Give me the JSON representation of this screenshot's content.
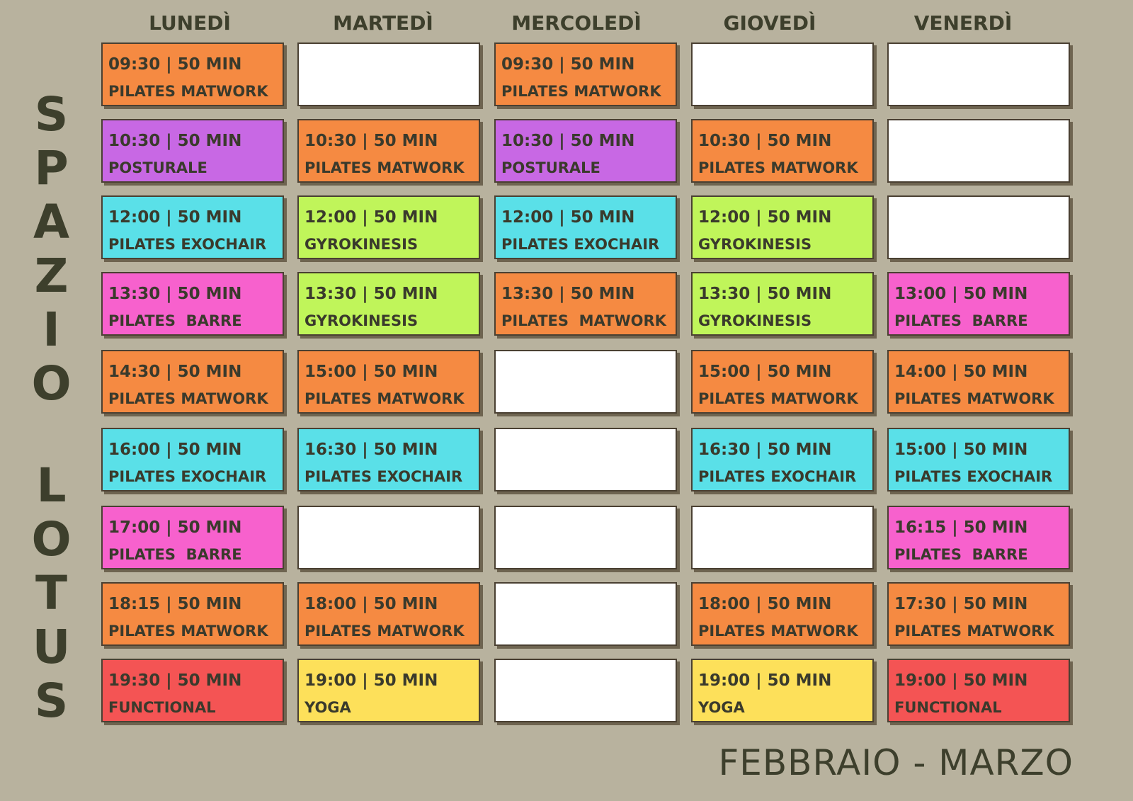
{
  "brand": {
    "word1": "SPAZIO",
    "word2": "LOTUS"
  },
  "days": [
    "LUNEDÌ",
    "MARTEDÌ",
    "MERCOLEDÌ",
    "GIOVEDÌ",
    "VENERDÌ"
  ],
  "colors": {
    "matwork": "#f58a42",
    "posturale": "#c868e4",
    "exochair": "#5ae0e8",
    "gyrokinesis": "#c0f55a",
    "barre": "#f761cd",
    "functional": "#f45454",
    "yoga": "#fde05a",
    "empty": "#ffffff"
  },
  "schedule": [
    [
      {
        "time": "09:30 | 50 MIN",
        "class": "PILATES MATWORK",
        "color": "#f58a42"
      },
      null,
      {
        "time": "09:30 | 50 MIN",
        "class": "PILATES MATWORK",
        "color": "#f58a42"
      },
      null,
      null
    ],
    [
      {
        "time": "10:30 | 50 MIN",
        "class": "POSTURALE",
        "color": "#c868e4"
      },
      {
        "time": "10:30 | 50 MIN",
        "class": "PILATES MATWORK",
        "color": "#f58a42"
      },
      {
        "time": "10:30 | 50 MIN",
        "class": "POSTURALE",
        "color": "#c868e4"
      },
      {
        "time": "10:30 | 50 MIN",
        "class": "PILATES MATWORK",
        "color": "#f58a42"
      },
      null
    ],
    [
      {
        "time": "12:00 | 50 MIN",
        "class": "PILATES EXOCHAIR",
        "color": "#5ae0e8"
      },
      {
        "time": "12:00 | 50 MIN",
        "class": "GYROKINESIS",
        "color": "#c0f55a"
      },
      {
        "time": "12:00 | 50 MIN",
        "class": "PILATES EXOCHAIR",
        "color": "#5ae0e8"
      },
      {
        "time": "12:00 | 50 MIN",
        "class": "GYROKINESIS",
        "color": "#c0f55a"
      },
      null
    ],
    [
      {
        "time": "13:30 | 50 MIN",
        "class": "PILATES  BARRE",
        "color": "#f761cd"
      },
      {
        "time": "13:30 | 50 MIN",
        "class": "GYROKINESIS",
        "color": "#c0f55a"
      },
      {
        "time": "13:30 | 50 MIN",
        "class": "PILATES  MATWORK",
        "color": "#f58a42"
      },
      {
        "time": "13:30 | 50 MIN",
        "class": "GYROKINESIS",
        "color": "#c0f55a"
      },
      {
        "time": "13:00 | 50 MIN",
        "class": "PILATES  BARRE",
        "color": "#f761cd"
      }
    ],
    [
      {
        "time": "14:30 | 50 MIN",
        "class": "PILATES MATWORK",
        "color": "#f58a42"
      },
      {
        "time": "15:00 | 50 MIN",
        "class": "PILATES MATWORK",
        "color": "#f58a42"
      },
      null,
      {
        "time": "15:00 | 50 MIN",
        "class": "PILATES MATWORK",
        "color": "#f58a42"
      },
      {
        "time": "14:00 | 50 MIN",
        "class": "PILATES MATWORK",
        "color": "#f58a42"
      }
    ],
    [
      {
        "time": "16:00 | 50 MIN",
        "class": "PILATES EXOCHAIR",
        "color": "#5ae0e8"
      },
      {
        "time": "16:30 | 50 MIN",
        "class": "PILATES EXOCHAIR",
        "color": "#5ae0e8"
      },
      null,
      {
        "time": "16:30 | 50 MIN",
        "class": "PILATES EXOCHAIR",
        "color": "#5ae0e8"
      },
      {
        "time": "15:00 | 50 MIN",
        "class": "PILATES EXOCHAIR",
        "color": "#5ae0e8"
      }
    ],
    [
      {
        "time": "17:00 | 50 MIN",
        "class": "PILATES  BARRE",
        "color": "#f761cd"
      },
      null,
      null,
      null,
      {
        "time": "16:15 | 50 MIN",
        "class": "PILATES  BARRE",
        "color": "#f761cd"
      }
    ],
    [
      {
        "time": "18:15 | 50 MIN",
        "class": "PILATES MATWORK",
        "color": "#f58a42"
      },
      {
        "time": "18:00 | 50 MIN",
        "class": "PILATES MATWORK",
        "color": "#f58a42"
      },
      null,
      {
        "time": "18:00 | 50 MIN",
        "class": "PILATES MATWORK",
        "color": "#f58a42"
      },
      {
        "time": "17:30 | 50 MIN",
        "class": "PILATES MATWORK",
        "color": "#f58a42"
      }
    ],
    [
      {
        "time": "19:30 | 50 MIN",
        "class": "FUNCTIONAL",
        "color": "#f45454"
      },
      {
        "time": "19:00 | 50 MIN",
        "class": "YOGA",
        "color": "#fde05a"
      },
      null,
      {
        "time": "19:00 | 50 MIN",
        "class": "YOGA",
        "color": "#fde05a"
      },
      {
        "time": "19:00 | 50 MIN",
        "class": "FUNCTIONAL",
        "color": "#f45454"
      }
    ]
  ],
  "period": "FEBBRAIO - MARZO"
}
